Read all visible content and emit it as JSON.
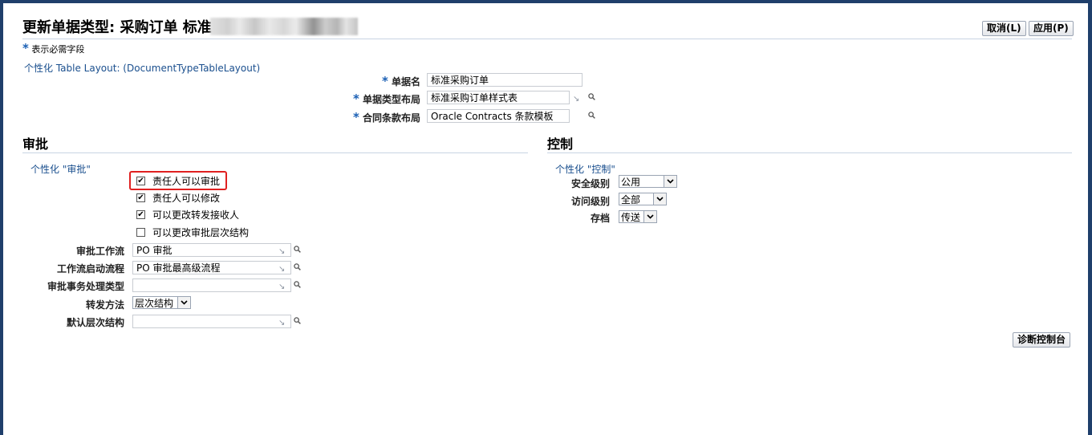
{
  "header": {
    "title": "更新单据类型: 采购订单 标准",
    "cancel_label": "取消(L)",
    "apply_label": "应用(P)"
  },
  "required_note": {
    "star": "*",
    "text": "表示必需字段"
  },
  "personalize_layout_link": "个性化 Table Layout: (DocumentTypeTableLayout)",
  "top_fields": {
    "doc_name": {
      "label": "单据名",
      "value": "标准采购订单"
    },
    "doc_type_layout": {
      "label": "单据类型布局",
      "value": "标准采购订单样式表"
    },
    "contract_layout": {
      "label": "合同条款布局",
      "value": "Oracle Contracts 条款模板"
    }
  },
  "approval": {
    "heading": "审批",
    "personalize_link": "个性化 \"审批\"",
    "checkboxes": [
      {
        "label": "责任人可以审批",
        "checked": true
      },
      {
        "label": "责任人可以修改",
        "checked": true
      },
      {
        "label": "可以更改转发接收人",
        "checked": true
      },
      {
        "label": "可以更改审批层次结构",
        "checked": false
      }
    ],
    "check_glyph": "✔",
    "fields": {
      "workflow": {
        "label": "审批工作流",
        "value": "PO 审批"
      },
      "startup_process": {
        "label": "工作流启动流程",
        "value": "PO 审批最高级流程"
      },
      "transaction_type": {
        "label": "审批事务处理类型",
        "value": ""
      },
      "forward_method": {
        "label": "转发方法",
        "value": "层次结构"
      },
      "default_hierarchy": {
        "label": "默认层次结构",
        "value": ""
      }
    }
  },
  "control": {
    "heading": "控制",
    "personalize_link": "个性化 \"控制\"",
    "security_level": {
      "label": "安全级别",
      "value": "公用"
    },
    "access_level": {
      "label": "访问级别",
      "value": "全部"
    },
    "archive": {
      "label": "存档",
      "value": "传送"
    }
  },
  "diagnostics_label": "诊断控制台",
  "colors": {
    "link": "#1a4f8e",
    "required_star": "#1a5fb4",
    "highlight": "#e02020",
    "frame": "#1f3f6b"
  }
}
